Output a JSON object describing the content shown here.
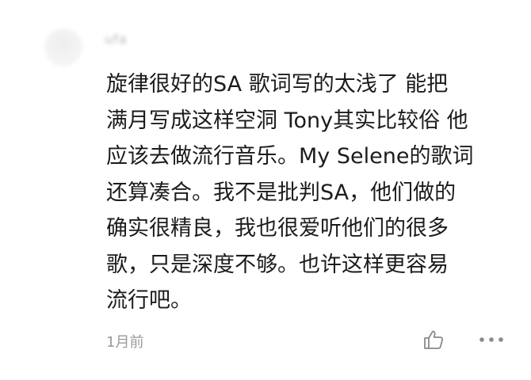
{
  "comment": {
    "username": "ufa",
    "lines": [
      "旋律很好的SA 歌词写的太浅了 能把",
      "满月写成这样空洞 Tony其实比较俗 他",
      "应该去做流行音乐。My Selene的歌词",
      "还算凑合。我不是批判SA，他们做的",
      "确实很精良，我也很爱听他们的很多",
      "歌，只是深度不够。也许这样更容易",
      "流行吧。"
    ],
    "timestamp": "1月前"
  },
  "icons": {
    "like": "thumbs-up-outline-icon",
    "more": "more-dots-icon"
  },
  "colors": {
    "text": "#1c1c1c",
    "meta": "#9a9a9a",
    "icon": "#8a8a8a"
  }
}
